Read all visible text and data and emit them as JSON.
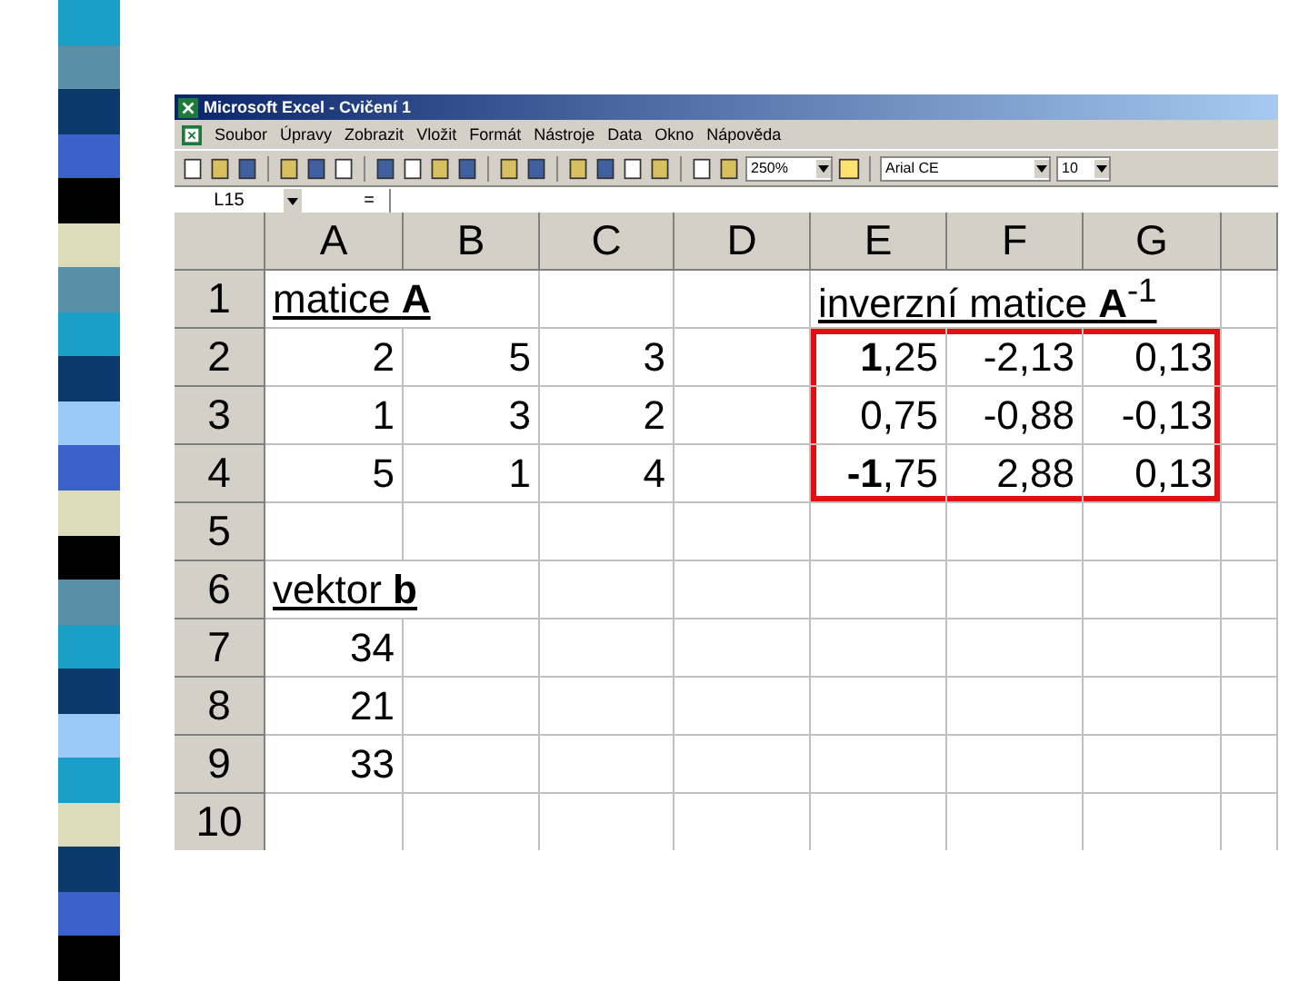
{
  "window": {
    "title": "Microsoft Excel - Cvičení 1"
  },
  "menu": [
    "Soubor",
    "Úpravy",
    "Zobrazit",
    "Vložit",
    "Formát",
    "Nástroje",
    "Data",
    "Okno",
    "Nápověda"
  ],
  "toolbar": {
    "zoom": "250%",
    "font": "Arial CE",
    "font_size": "10"
  },
  "formula_bar": {
    "name_box": "L15",
    "equals": "="
  },
  "columns": [
    "A",
    "B",
    "C",
    "D",
    "E",
    "F",
    "G"
  ],
  "rows": [
    {
      "header": "1",
      "cells": [
        {
          "kind": "text",
          "text": "matice **A**",
          "underline": true
        },
        {
          "kind": "empty"
        },
        {
          "kind": "empty"
        },
        {
          "kind": "empty"
        },
        {
          "kind": "text",
          "text": "inverzní matice **A**$^{-1}$",
          "underline": true
        },
        {
          "kind": "empty"
        },
        {
          "kind": "empty"
        }
      ]
    },
    {
      "header": "2",
      "cells": [
        {
          "kind": "number",
          "text": "2"
        },
        {
          "kind": "number",
          "text": "5"
        },
        {
          "kind": "number",
          "text": "3"
        },
        {
          "kind": "empty"
        },
        {
          "kind": "number",
          "text": "**1**,25",
          "highlighted": true
        },
        {
          "kind": "number",
          "text": "-2,13",
          "highlighted": true
        },
        {
          "kind": "number",
          "text": "0,13",
          "highlighted": true
        }
      ]
    },
    {
      "header": "3",
      "cells": [
        {
          "kind": "number",
          "text": "1"
        },
        {
          "kind": "number",
          "text": "3"
        },
        {
          "kind": "number",
          "text": "2"
        },
        {
          "kind": "empty"
        },
        {
          "kind": "number",
          "text": "0,75",
          "highlighted": true
        },
        {
          "kind": "number",
          "text": "-0,88"
        },
        {
          "kind": "number",
          "text": "-0,13",
          "highlighted": true
        }
      ]
    },
    {
      "header": "4",
      "cells": [
        {
          "kind": "number",
          "text": "5"
        },
        {
          "kind": "number",
          "text": "1"
        },
        {
          "kind": "number",
          "text": "4"
        },
        {
          "kind": "empty"
        },
        {
          "kind": "number",
          "text": "**-1**,75",
          "highlighted": true
        },
        {
          "kind": "number",
          "text": "2,88",
          "highlighted": true
        },
        {
          "kind": "number",
          "text": "0,13",
          "highlighted": true
        }
      ]
    },
    {
      "header": "5",
      "cells": []
    },
    {
      "header": "6",
      "cells": [
        {
          "kind": "text",
          "text": "vektor **b**",
          "underline": true
        }
      ]
    },
    {
      "header": "7",
      "cells": [
        {
          "kind": "number",
          "text": "34"
        }
      ]
    },
    {
      "header": "8",
      "cells": [
        {
          "kind": "number",
          "text": "21"
        }
      ]
    },
    {
      "header": "9",
      "cells": [
        {
          "kind": "number",
          "text": "33"
        }
      ]
    },
    {
      "header": "10",
      "cells": []
    }
  ]
}
